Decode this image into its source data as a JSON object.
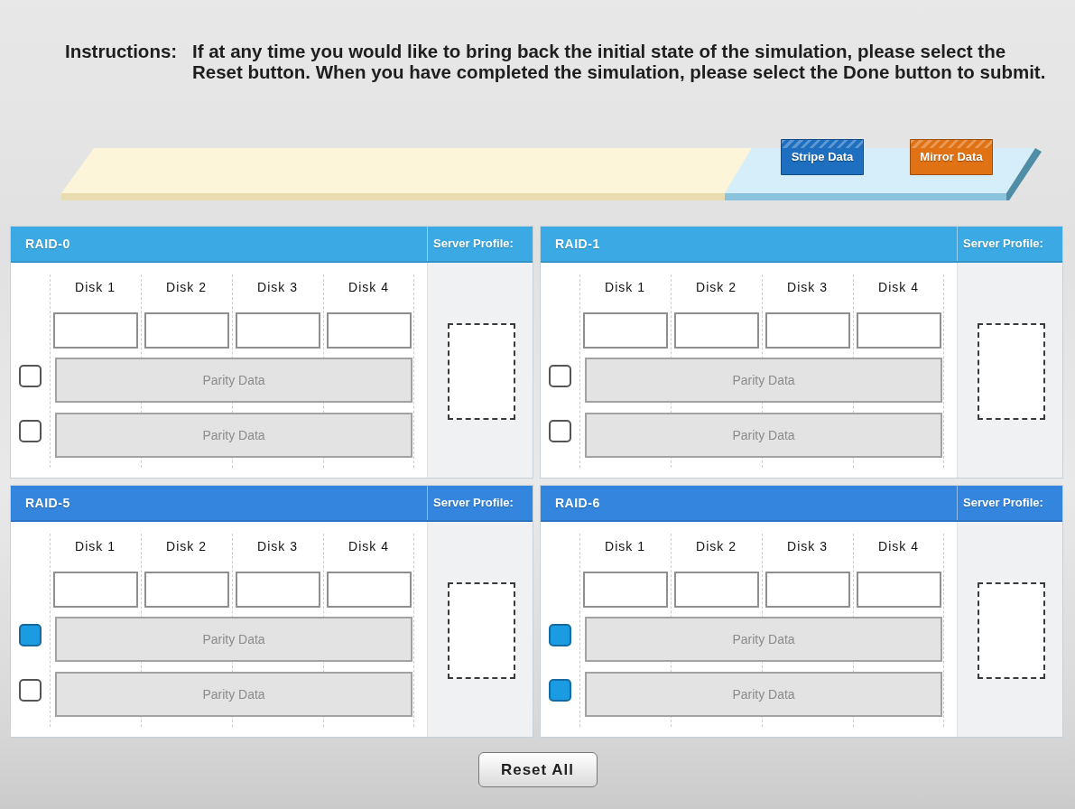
{
  "instructions": {
    "label": "Instructions:",
    "text": "If at any time you would like to bring back the initial state of the simulation, please select the Reset button. When you have completed the simulation, please select the Done button to submit."
  },
  "data_buttons": [
    {
      "label": "Stripe Data",
      "color": "#1e6fc0"
    },
    {
      "label": "Mirror Data",
      "color": "#e07214"
    }
  ],
  "panels": [
    {
      "title": "RAID-0",
      "color": "#3aa9e4",
      "profile_label": "Server Profile:",
      "disks": [
        "Disk 1",
        "Disk 2",
        "Disk 3",
        "Disk 4"
      ],
      "parity_rows": [
        {
          "label": "Parity Data",
          "checked": false
        },
        {
          "label": "Parity Data",
          "checked": false
        }
      ]
    },
    {
      "title": "RAID-1",
      "color": "#3aa9e4",
      "profile_label": "Server Profile:",
      "disks": [
        "Disk 1",
        "Disk 2",
        "Disk 3",
        "Disk 4"
      ],
      "parity_rows": [
        {
          "label": "Parity Data",
          "checked": false
        },
        {
          "label": "Parity Data",
          "checked": false
        }
      ]
    },
    {
      "title": "RAID-5",
      "color": "#3385dd",
      "profile_label": "Server Profile:",
      "disks": [
        "Disk 1",
        "Disk 2",
        "Disk 3",
        "Disk 4"
      ],
      "parity_rows": [
        {
          "label": "Parity Data",
          "checked": true
        },
        {
          "label": "Parity Data",
          "checked": false
        }
      ]
    },
    {
      "title": "RAID-6",
      "color": "#3385dd",
      "profile_label": "Server Profile:",
      "disks": [
        "Disk 1",
        "Disk 2",
        "Disk 3",
        "Disk 4"
      ],
      "parity_rows": [
        {
          "label": "Parity Data",
          "checked": true
        },
        {
          "label": "Parity Data",
          "checked": true
        }
      ]
    }
  ],
  "reset_button": {
    "label": "Reset All"
  }
}
